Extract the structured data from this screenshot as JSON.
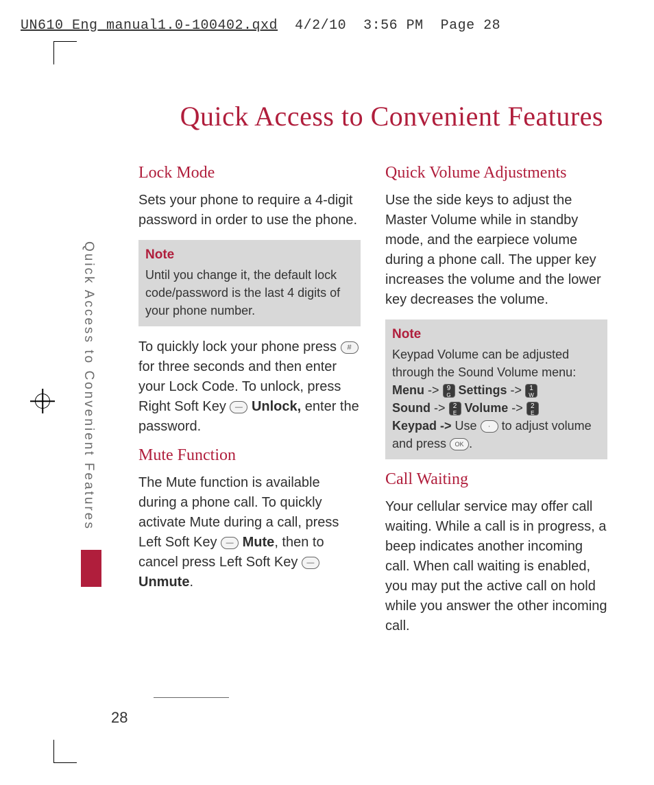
{
  "header": {
    "filename": "UN610_Eng_manual1.0-100402.qxd",
    "date": "4/2/10",
    "time": "3:56 PM",
    "page_label": "Page 28"
  },
  "page": {
    "title": "Quick Access to Convenient Features",
    "side_label": "Quick Access to Convenient Features",
    "number": "28"
  },
  "col1": {
    "h_lock": "Lock Mode",
    "p_lock": "Sets your phone to require a 4-digit password in order to use the phone.",
    "note1_title": "Note",
    "note1_body": "Until you change it, the default lock code/password is the last 4 digits of your phone number.",
    "p_lock2a": "To quickly lock your phone press ",
    "p_lock2b": " for three seconds and then enter your Lock Code. To unlock, press Right Soft Key ",
    "p_lock2c": " Unlock, enter the password.",
    "unlock_bold": "Unlock,",
    "h_mute": "Mute Function",
    "p_mute_a": "The Mute function is available during a phone call. To quickly activate Mute during a call, press Left Soft Key ",
    "mute_bold": "Mute",
    "p_mute_b": ", then to cancel press Left Soft Key ",
    "unmute_bold": "Unmute",
    "p_mute_c": "."
  },
  "col2": {
    "h_vol": "Quick Volume Adjustments",
    "p_vol": "Use the side keys to adjust the Master Volume while in standby mode, and the earpiece volume during a phone call. The upper key increases the volume and the lower key decreases the volume.",
    "note2_title": "Note",
    "note2_line1": "Keypad Volume can be adjusted through the Sound Volume menu:",
    "menu": "Menu",
    "settings": "Settings",
    "sound": "Sound",
    "volume": "Volume",
    "keypad": "Keypad ->",
    "arrow": " -> ",
    "use": "Use ",
    "note2_tail": " to adjust volume and press ",
    "period": ".",
    "h_call": "Call Waiting",
    "p_call": "Your cellular service may offer call waiting. While a call is in progress, a beep indicates another incoming call. When call waiting is enabled, you may put the active call on hold while you answer the other incoming call."
  },
  "keys": {
    "hash": "#",
    "softkey": "—",
    "k9": "9",
    "k1": "1",
    "k2": "2",
    "nav": "·",
    "ok": "OK"
  }
}
